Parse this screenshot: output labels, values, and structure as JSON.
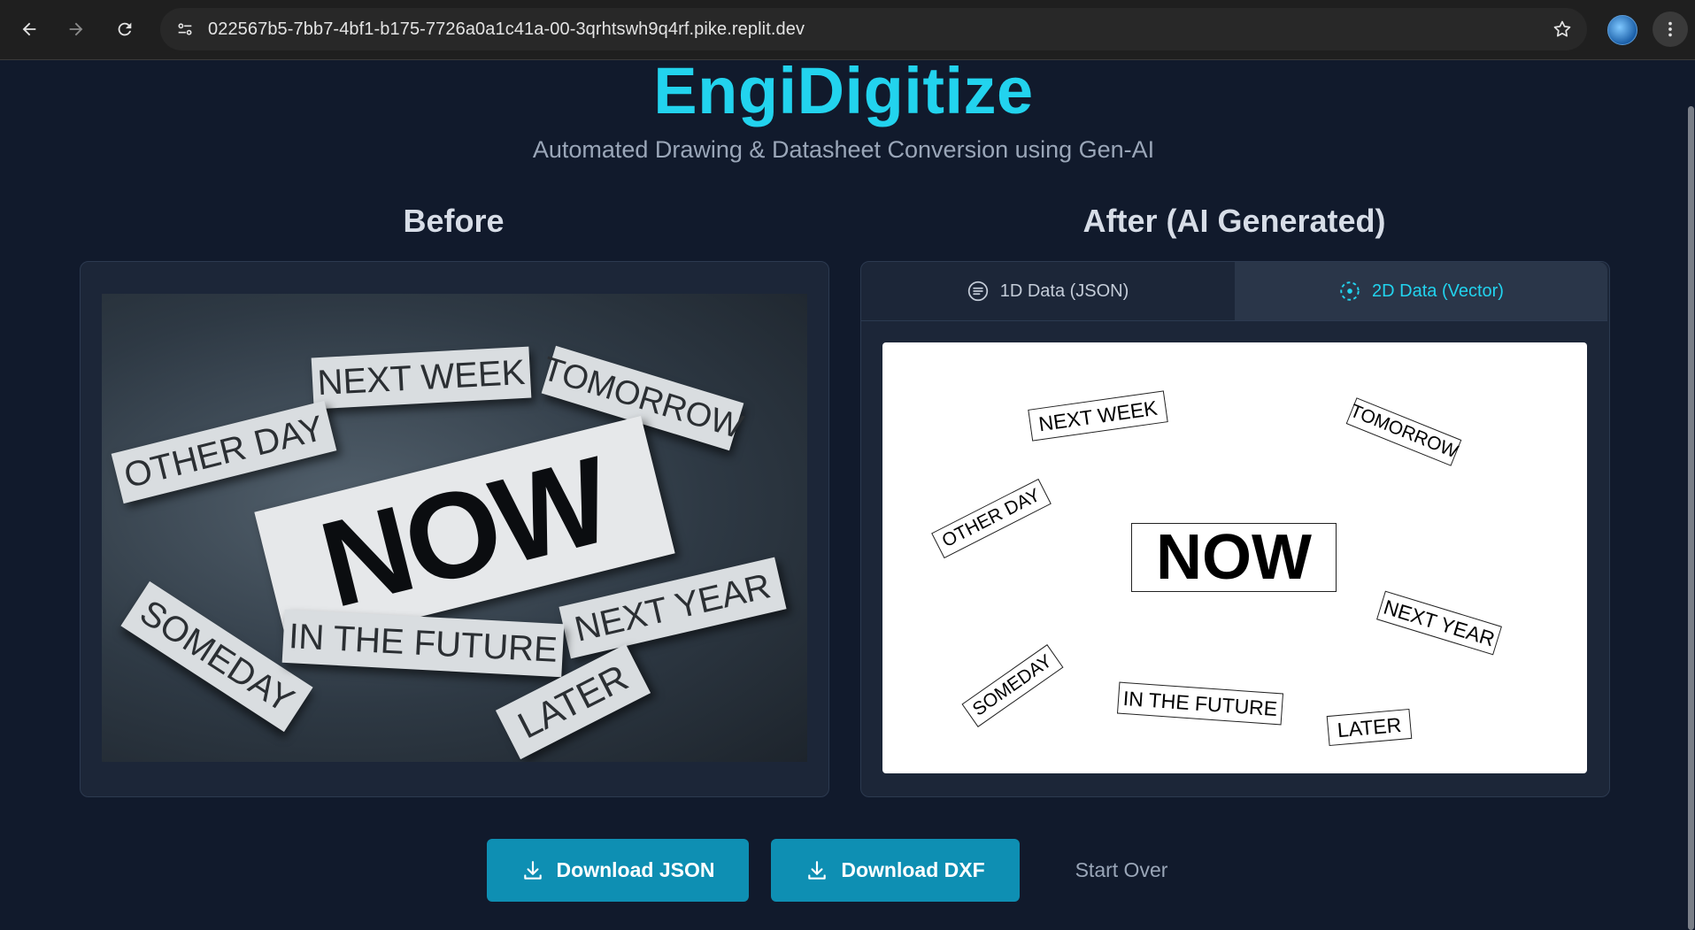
{
  "browser": {
    "url": "022567b5-7bb7-4bf1-b175-7726a0a1c41a-00-3qrhtswh9q4rf.pike.replit.dev"
  },
  "header": {
    "title": "EngiDigitize",
    "subtitle": "Automated Drawing & Datasheet Conversion using Gen-AI"
  },
  "before": {
    "heading": "Before",
    "photo_words": {
      "next_week": "NEXT WEEK",
      "tomorrow": "TOMORROW",
      "other_day": "OTHER DAY",
      "now": "NOW",
      "next_year": "NEXT YEAR",
      "someday": "SOMEDAY",
      "in_the_future": "IN THE FUTURE",
      "later": "LATER"
    }
  },
  "after": {
    "heading": "After (AI Generated)",
    "tabs": {
      "json": "1D Data (JSON)",
      "vector": "2D Data (Vector)"
    },
    "vector_words": {
      "next_week": "NEXT WEEK",
      "tomorrow": "TOMORROW",
      "other_day": "OTHER DAY",
      "now": "NOW",
      "next_year": "NEXT YEAR",
      "someday": "SOMEDAY",
      "in_the_future": "IN THE FUTURE",
      "later": "LATER"
    }
  },
  "actions": {
    "download_json": "Download JSON",
    "download_dxf": "Download DXF",
    "start_over": "Start Over"
  },
  "colors": {
    "accent": "#22d3ee",
    "button": "#0e8fb3",
    "background": "#111a2c"
  }
}
